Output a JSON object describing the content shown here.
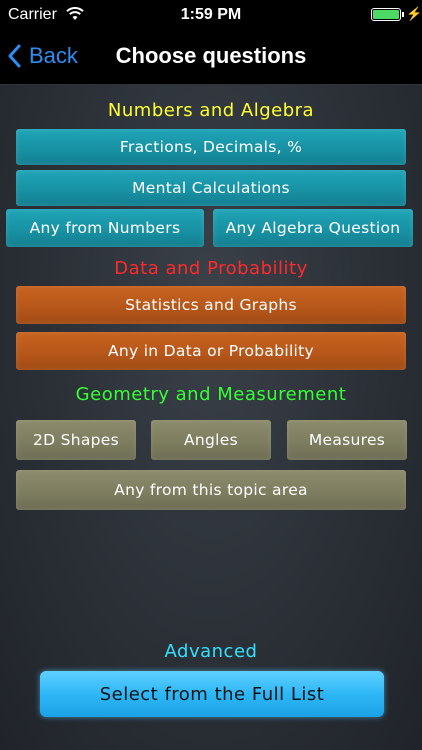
{
  "status_bar": {
    "carrier": "Carrier",
    "time": "1:59 PM"
  },
  "nav": {
    "back_label": "Back",
    "title": "Choose questions"
  },
  "sections": {
    "numbers": {
      "heading": "Numbers and Algebra",
      "color": "#ffff33",
      "fractions": "Fractions, Decimals, %",
      "mental": "Mental Calculations",
      "any_numbers": "Any from Numbers",
      "any_algebra": "Any Algebra Question"
    },
    "data": {
      "heading": "Data and Probability",
      "color": "#ff2a2a",
      "statistics": "Statistics and Graphs",
      "any_data": "Any in Data or Probability"
    },
    "geometry": {
      "heading": "Geometry and Measurement",
      "color": "#33ff33",
      "shapes": "2D Shapes",
      "angles": "Angles",
      "measures": "Measures",
      "any_topic": "Any from this topic area"
    },
    "advanced": {
      "heading": "Advanced",
      "color": "#33e0ff",
      "full_list": "Select from the Full List"
    }
  },
  "colors": {
    "ios_blue": "#2b8ef3",
    "battery_green": "#4cd964"
  },
  "icons": [
    "wifi-icon",
    "battery-icon",
    "charging-bolt-icon",
    "back-chevron-icon"
  ]
}
